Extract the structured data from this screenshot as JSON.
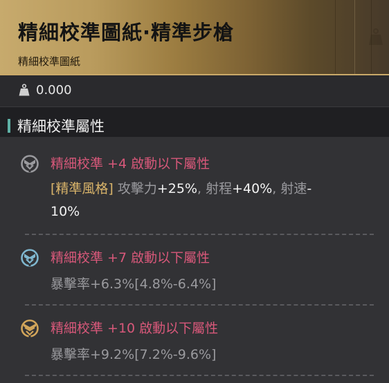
{
  "header": {
    "title": "精細校準圖紙·精準步槍",
    "subtitle": "精細校準圖紙"
  },
  "weight": {
    "icon": "weight-icon",
    "value": "0.000"
  },
  "section": {
    "title": "精細校準屬性",
    "accent": "#5fb1a6"
  },
  "entries": [
    {
      "icon": "calibration-tier-1-icon",
      "title": "精細校準 +4 啟動以下屬性",
      "tag": "[精準風格]",
      "line1_a": " 攻擊力",
      "line1_b": "+25%",
      "line1_c": ", 射程",
      "line1_d": "+40%",
      "line1_e": ", 射速",
      "line1_f": "-",
      "line2": "10%"
    },
    {
      "icon": "calibration-tier-2-icon",
      "title": "精細校準 +7 啟動以下屬性",
      "line": "暴擊率+6.3%[4.8%-6.4%]"
    },
    {
      "icon": "calibration-tier-3-icon",
      "title": "精細校準 +10 啟動以下屬性",
      "line": "暴擊率+9.2%[7.2%-9.6%]"
    }
  ],
  "colors": {
    "header_gold": "#c7aa6d",
    "title_pink": "#d8587a",
    "tag_gold": "#d9b46a"
  }
}
